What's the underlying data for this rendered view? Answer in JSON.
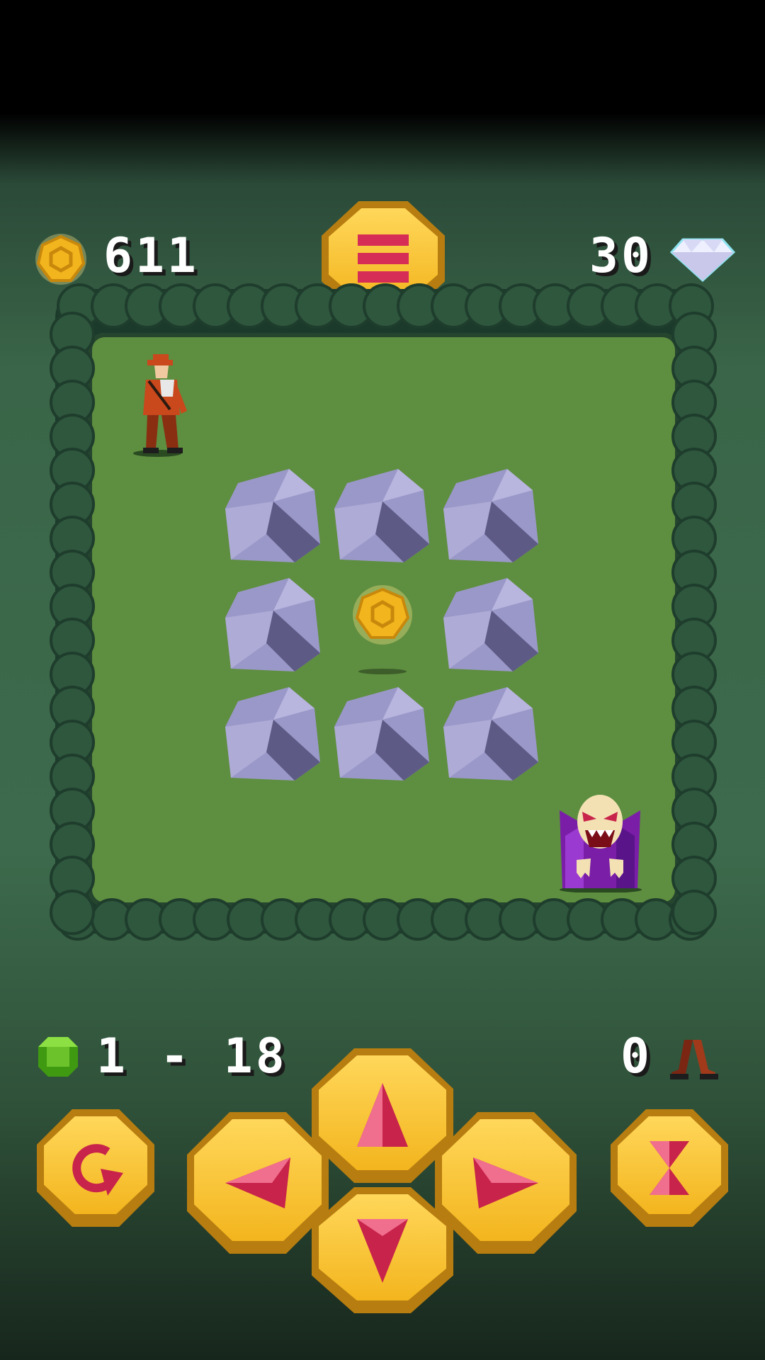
{
  "hud": {
    "coins": "611",
    "gems": "30",
    "level": "1 - 18",
    "steps": "0"
  },
  "icons": {
    "coin": "gold-coin-icon",
    "diamond": "diamond-icon",
    "level_gem": "green-gem-icon",
    "steps": "footsteps-icon",
    "menu": "menu-icon"
  },
  "board": {
    "rows": 3,
    "cols": 3,
    "cells": [
      [
        "rock",
        "rock",
        "rock"
      ],
      [
        "rock",
        "coin",
        "rock"
      ],
      [
        "rock",
        "rock",
        "rock"
      ]
    ],
    "characters": [
      "explorer",
      "vampire"
    ]
  },
  "controls": [
    "undo-button",
    "left-button",
    "up-button",
    "right-button",
    "down-button",
    "wait-button"
  ],
  "colors": {
    "button_gold": "#f3b51e",
    "button_dark": "#b77d10",
    "gem_red": "#c8234a",
    "grass": "#5e8e3f",
    "rock": "#8f8cbd"
  }
}
